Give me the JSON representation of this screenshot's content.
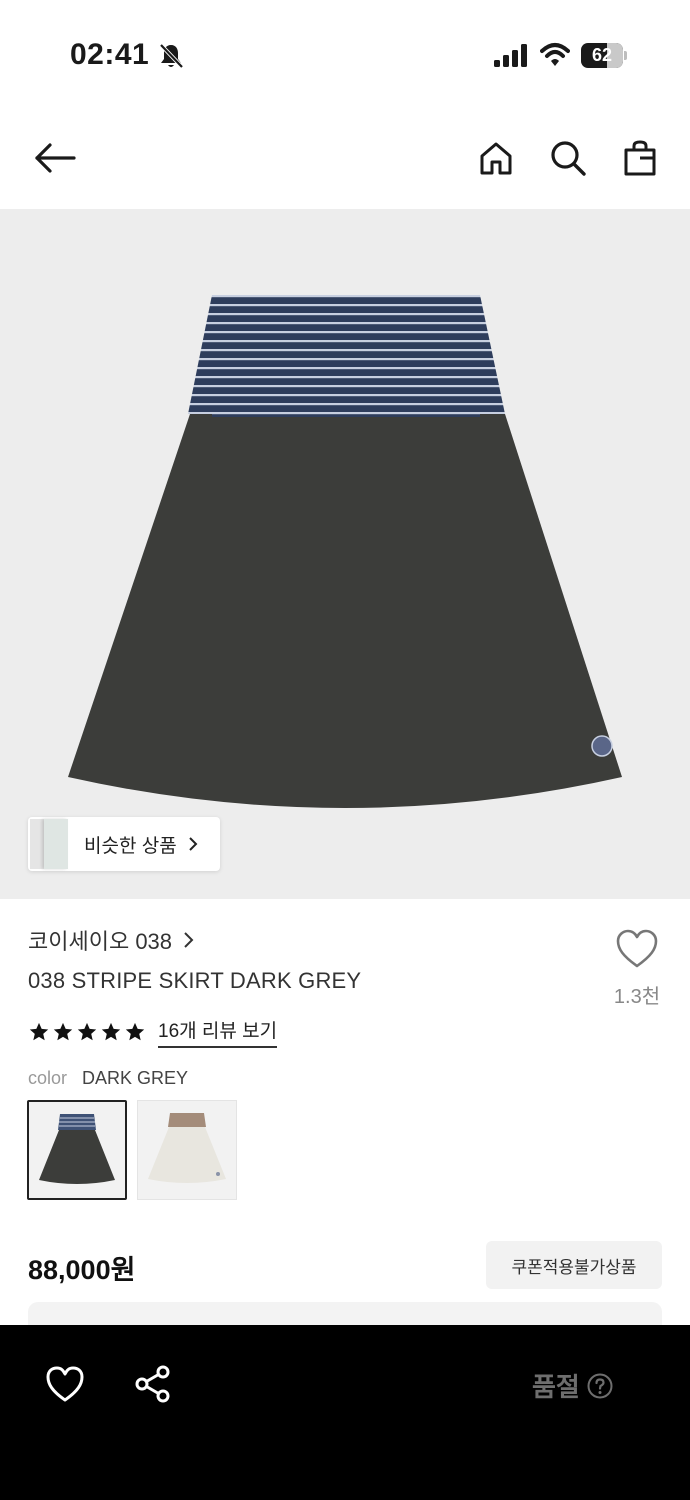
{
  "status_bar": {
    "time": "02:41",
    "battery": "62",
    "battery_level": 0.62,
    "icons": [
      "bell-slash-icon",
      "cellular-signal-icon",
      "wifi-icon",
      "battery-icon"
    ]
  },
  "nav": {
    "icons": [
      "back-arrow-icon",
      "home-icon",
      "search-icon",
      "shopping-bag-icon"
    ]
  },
  "image": {
    "similar_label": "비슷한 상품",
    "colors": {
      "background": "#ededed",
      "waistband": "#2e3d5c",
      "stripe": "#c7cfe0",
      "body": "#3c3d3a"
    }
  },
  "product": {
    "brand": "코이세이오 038",
    "name": "038 STRIPE SKIRT DARK GREY",
    "likes": "1.3천",
    "rating": 5,
    "review_link": "16개 리뷰 보기",
    "color_label": "color",
    "color_value": "DARK GREY",
    "variants": [
      {
        "name": "DARK GREY",
        "selected": true,
        "waistband": "#2e3d5c",
        "body": "#3c3d3a",
        "bg": "#f2f2f2"
      },
      {
        "name": "IVORY",
        "selected": false,
        "waistband": "#a48c7a",
        "body": "#e8e6df",
        "bg": "#f2f2f2"
      }
    ],
    "price": "88,000원",
    "coupon_badge": "쿠폰적용불가상품"
  },
  "bottom_bar": {
    "status": "품절",
    "icons": [
      "heart-icon",
      "share-icon",
      "help-circle-icon"
    ]
  }
}
